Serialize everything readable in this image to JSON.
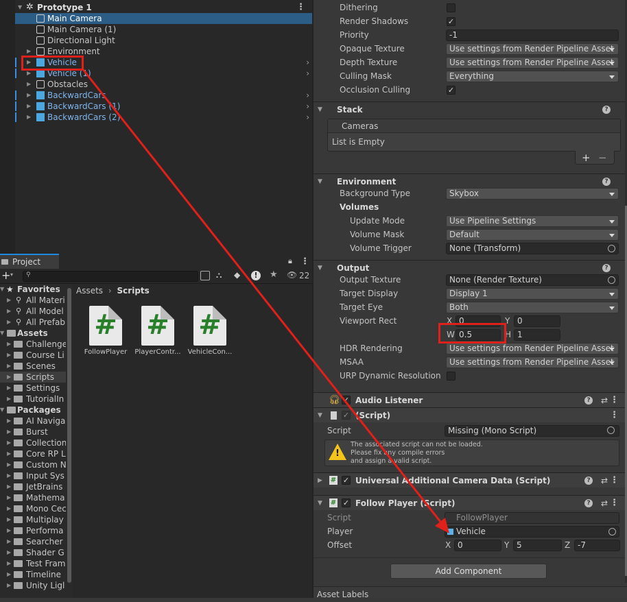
{
  "hierarchy": {
    "scene": "Prototype 1",
    "items": [
      {
        "label": "Main Camera",
        "selected": true
      },
      {
        "label": "Main Camera (1)"
      },
      {
        "label": "Directional Light"
      },
      {
        "label": "Environment"
      },
      {
        "label": "Vehicle",
        "prefab": true
      },
      {
        "label": "Vehicle (1)",
        "prefab": true
      },
      {
        "label": "Obstacles"
      },
      {
        "label": "BackwardCars",
        "prefab": true
      },
      {
        "label": "BackwardCars (1)",
        "prefab": true
      },
      {
        "label": "BackwardCars (2)",
        "prefab": true
      }
    ]
  },
  "project": {
    "tab": "Project",
    "count": "22",
    "search_placeholder": "",
    "breadcrumb": [
      "Assets",
      "Scripts"
    ],
    "tree": [
      {
        "label": "Favorites",
        "hdr": true,
        "icon": "star"
      },
      {
        "label": "All Materi",
        "icon": "search"
      },
      {
        "label": "All Model",
        "icon": "search"
      },
      {
        "label": "All Prefab",
        "icon": "search"
      },
      {
        "label": "Assets",
        "hdr": true,
        "icon": "folder"
      },
      {
        "label": "Challenge",
        "icon": "folder"
      },
      {
        "label": "Course Li",
        "icon": "folder"
      },
      {
        "label": "Scenes",
        "icon": "folder"
      },
      {
        "label": "Scripts",
        "icon": "folder",
        "selected": true
      },
      {
        "label": "Settings",
        "icon": "folder"
      },
      {
        "label": "TutorialIn",
        "icon": "folder"
      },
      {
        "label": "Packages",
        "hdr": true,
        "icon": "folder"
      },
      {
        "label": "AI Naviga",
        "icon": "folder"
      },
      {
        "label": "Burst",
        "icon": "folder"
      },
      {
        "label": "Collection",
        "icon": "folder"
      },
      {
        "label": "Core RP L",
        "icon": "folder"
      },
      {
        "label": "Custom N",
        "icon": "folder"
      },
      {
        "label": "Input Sys",
        "icon": "folder"
      },
      {
        "label": "JetBrains",
        "icon": "folder"
      },
      {
        "label": "Mathema",
        "icon": "folder"
      },
      {
        "label": "Mono Cec",
        "icon": "folder"
      },
      {
        "label": "Multiplay",
        "icon": "folder"
      },
      {
        "label": "Performa",
        "icon": "folder"
      },
      {
        "label": "Searcher",
        "icon": "folder"
      },
      {
        "label": "Shader G",
        "icon": "folder"
      },
      {
        "label": "Test Fram",
        "icon": "folder"
      },
      {
        "label": "Timeline",
        "icon": "folder"
      },
      {
        "label": "Unity Ligl",
        "icon": "folder"
      }
    ],
    "assets": [
      {
        "name": "FollowPlayer"
      },
      {
        "name": "PlayerContr..."
      },
      {
        "name": "VehicleCon..."
      }
    ]
  },
  "inspector": {
    "top_rows": [
      {
        "label": "Dithering",
        "type": "check",
        "checked": false
      },
      {
        "label": "Render Shadows",
        "type": "check",
        "checked": true
      },
      {
        "label": "Priority",
        "type": "field",
        "value": "-1"
      },
      {
        "label": "Opaque Texture",
        "type": "drop",
        "value": "Use settings from Render Pipeline Asset"
      },
      {
        "label": "Depth Texture",
        "type": "drop",
        "value": "Use settings from Render Pipeline Asset"
      },
      {
        "label": "Culling Mask",
        "type": "drop",
        "value": "Everything"
      },
      {
        "label": "Occlusion Culling",
        "type": "check",
        "checked": true
      }
    ],
    "stack": {
      "title": "Stack",
      "list_header": "Cameras",
      "empty": "List is Empty",
      "add": "+",
      "remove": "−"
    },
    "environment": {
      "title": "Environment",
      "background_label": "Background Type",
      "background_value": "Skybox",
      "volumes": "Volumes",
      "rows": [
        {
          "label": "Update Mode",
          "value": "Use Pipeline Settings",
          "type": "drop"
        },
        {
          "label": "Volume Mask",
          "value": "Default",
          "type": "drop"
        },
        {
          "label": "Volume Trigger",
          "value": "None (Transform)",
          "type": "obj"
        }
      ]
    },
    "output": {
      "title": "Output",
      "rows": [
        {
          "label": "Output Texture",
          "value": "None (Render Texture)",
          "type": "obj"
        },
        {
          "label": "Target Display",
          "value": "Display 1",
          "type": "drop"
        },
        {
          "label": "Target Eye",
          "value": "Both",
          "type": "drop"
        }
      ],
      "viewport_label": "Viewport Rect",
      "x": "0",
      "y": "0",
      "w": "0.5",
      "h": "1",
      "rows2": [
        {
          "label": "HDR Rendering",
          "value": "Use settings from Render Pipeline Asset",
          "type": "drop"
        },
        {
          "label": "MSAA",
          "value": "Use settings from Render Pipeline Asset",
          "type": "drop"
        }
      ],
      "urp_label": "URP Dynamic Resolution"
    },
    "audio_listener": "Audio Listener",
    "missing": {
      "title": "(Script)",
      "script_label": "Script",
      "script_value": "Missing (Mono Script)",
      "warning": [
        "The associated script can not be loaded.",
        "Please fix any compile errors",
        "and assign a valid script."
      ]
    },
    "uacd": "Universal Additional Camera Data (Script)",
    "follow": {
      "title": "Follow Player (Script)",
      "script_label": "Script",
      "script_value": "FollowPlayer",
      "player_label": "Player",
      "player_value": "Vehicle",
      "offset_label": "Offset",
      "x": "0",
      "y": "5",
      "z": "-7"
    },
    "add_component": "Add Component",
    "asset_labels": "Asset Labels",
    "axis": {
      "x": "X",
      "y": "Y",
      "z": "Z",
      "w": "W",
      "h": "H"
    }
  },
  "colors": {
    "selection": "#2c5d87",
    "prefab_text": "#7fb5ee",
    "annotation": "#e0201a",
    "script_green": "#2a7f2a"
  }
}
